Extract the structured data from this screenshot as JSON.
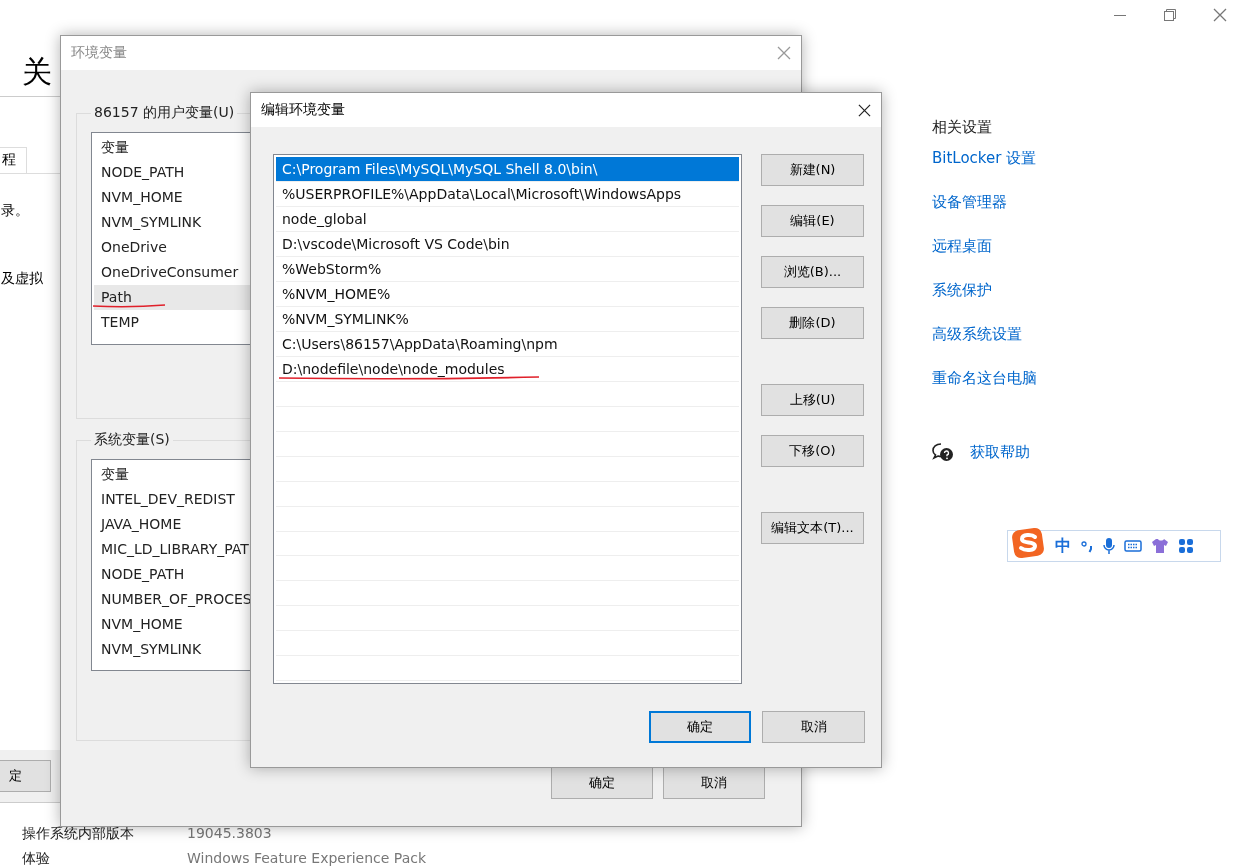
{
  "settings_page": {
    "title": "关",
    "info_rows": [
      {
        "label": "操作系统内部版本",
        "value": "19045.3803"
      },
      {
        "label": "体验",
        "value": "Windows Feature Experience Pack"
      }
    ],
    "related": {
      "heading": "相关设置",
      "links": [
        "BitLocker 设置",
        "设备管理器",
        "远程桌面",
        "系统保护",
        "高级系统设置",
        "重命名这台电脑"
      ]
    },
    "help_link": "获取帮助"
  },
  "system_properties": {
    "tab": "程",
    "texts": [
      "录。",
      "及虚拟"
    ],
    "button": "定"
  },
  "env_dialog": {
    "title": "环境变量",
    "user_group": {
      "label": "86157 的用户变量(U)",
      "header": "变量",
      "rows": [
        {
          "name": "NODE_PATH",
          "selected": false,
          "marked": false
        },
        {
          "name": "NVM_HOME",
          "selected": false,
          "marked": false
        },
        {
          "name": "NVM_SYMLINK",
          "selected": false,
          "marked": false
        },
        {
          "name": "OneDrive",
          "selected": false,
          "marked": false
        },
        {
          "name": "OneDriveConsumer",
          "selected": false,
          "marked": false
        },
        {
          "name": "Path",
          "selected": true,
          "marked": true
        },
        {
          "name": "TEMP",
          "selected": false,
          "marked": false
        }
      ]
    },
    "system_group": {
      "label": "系统变量(S)",
      "header": "变量",
      "rows": [
        {
          "name": "INTEL_DEV_REDIST",
          "selected": false,
          "marked": false
        },
        {
          "name": "JAVA_HOME",
          "selected": false,
          "marked": false
        },
        {
          "name": "MIC_LD_LIBRARY_PAT",
          "selected": false,
          "marked": false
        },
        {
          "name": "NODE_PATH",
          "selected": false,
          "marked": false
        },
        {
          "name": "NUMBER_OF_PROCES",
          "selected": false,
          "marked": false
        },
        {
          "name": "NVM_HOME",
          "selected": false,
          "marked": false
        },
        {
          "name": "NVM_SYMLINK",
          "selected": false,
          "marked": false
        }
      ]
    },
    "buttons": [
      {
        "label": "确定",
        "focused": false
      },
      {
        "label": "取消",
        "focused": false
      }
    ]
  },
  "edit_dialog": {
    "title": "编辑环境变量",
    "entries": [
      {
        "value": "C:\\Program Files\\MySQL\\MySQL Shell 8.0\\bin\\",
        "selected": true,
        "marked": false
      },
      {
        "value": "%USERPROFILE%\\AppData\\Local\\Microsoft\\WindowsApps",
        "selected": false,
        "marked": false
      },
      {
        "value": "node_global",
        "selected": false,
        "marked": false
      },
      {
        "value": "D:\\vscode\\Microsoft VS Code\\bin",
        "selected": false,
        "marked": false
      },
      {
        "value": "%WebStorm%",
        "selected": false,
        "marked": false
      },
      {
        "value": "%NVM_HOME%",
        "selected": false,
        "marked": false
      },
      {
        "value": "%NVM_SYMLINK%",
        "selected": false,
        "marked": false
      },
      {
        "value": "C:\\Users\\86157\\AppData\\Roaming\\npm",
        "selected": false,
        "marked": false
      },
      {
        "value": "D:\\nodefile\\node\\node_modules",
        "selected": false,
        "marked": true
      }
    ],
    "side_button_groups": [
      [
        "新建(N)",
        "编辑(E)",
        "浏览(B)...",
        "删除(D)"
      ],
      [
        "上移(U)",
        "下移(O)"
      ],
      [
        "编辑文本(T)..."
      ]
    ],
    "buttons": [
      {
        "label": "确定",
        "focused": true
      },
      {
        "label": "取消",
        "focused": false
      }
    ]
  },
  "ime_toolbar": {
    "mode": "中"
  }
}
